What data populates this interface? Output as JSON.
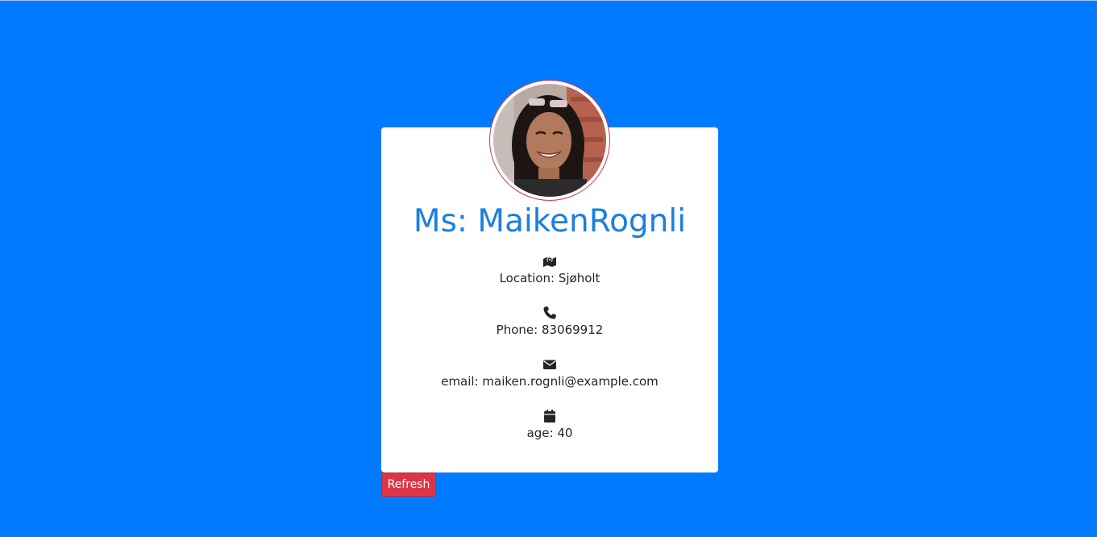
{
  "profile": {
    "name": "Ms: MaikenRognli",
    "avatar": "user-photo",
    "location": "Location: Sjøholt",
    "phone": "Phone: 83069912",
    "email": "email: maiken.rognli@example.com",
    "age": "age: 40"
  },
  "icons": {
    "location": "map-marker-icon",
    "phone": "phone-icon",
    "email": "envelope-icon",
    "age": "calendar-icon"
  },
  "actions": {
    "refresh_label": "Refresh"
  },
  "colors": {
    "background": "#007bff",
    "name": "#1a7fe0",
    "button": "#dc3545",
    "avatar_border": "#dc3545"
  }
}
